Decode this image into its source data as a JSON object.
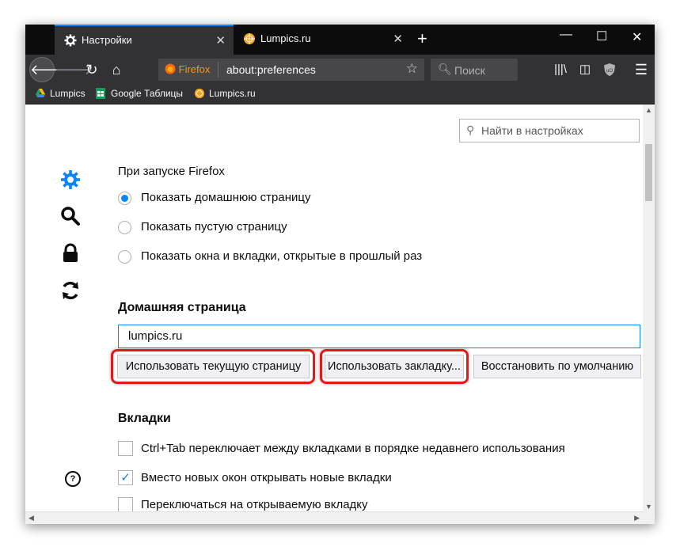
{
  "tabs": [
    {
      "label": "Настройки",
      "icon": "gear-icon",
      "active": true
    },
    {
      "label": "Lumpics.ru",
      "icon": "orange-favicon",
      "active": false
    }
  ],
  "navbar": {
    "identity_label": "Firefox",
    "url": "about:preferences",
    "search_placeholder": "Поиск"
  },
  "bookmarks": [
    {
      "label": "Lumpics",
      "icon": "google-drive-icon"
    },
    {
      "label": "Google Таблицы",
      "icon": "google-sheets-icon"
    },
    {
      "label": "Lumpics.ru",
      "icon": "orange-favicon"
    }
  ],
  "search": {
    "placeholder": "Найти в настройках"
  },
  "startup": {
    "heading": "При запуске Firefox",
    "options": [
      {
        "label": "Показать домашнюю страницу",
        "selected": true
      },
      {
        "label": "Показать пустую страницу",
        "selected": false
      },
      {
        "label": "Показать окна и вкладки, открытые в прошлый раз",
        "selected": false
      }
    ]
  },
  "homepage": {
    "heading": "Домашняя страница",
    "value": "lumpics.ru",
    "buttons": {
      "use_current": "Использовать текущую страницу",
      "use_bookmark": "Использовать закладку...",
      "restore_default": "Восстановить по умолчанию"
    }
  },
  "tabs_section": {
    "heading": "Вкладки",
    "options": [
      {
        "label": "Ctrl+Tab переключает между вкладками в порядке недавнего использования",
        "checked": false
      },
      {
        "label": "Вместо новых окон открывать новые вкладки",
        "checked": true
      },
      {
        "label": "Переключаться на открываемую вкладку",
        "checked": false
      }
    ]
  },
  "colors": {
    "accent": "#0a84ff",
    "highlight": "#e11919",
    "chrome_dark": "#0c0c0d"
  }
}
